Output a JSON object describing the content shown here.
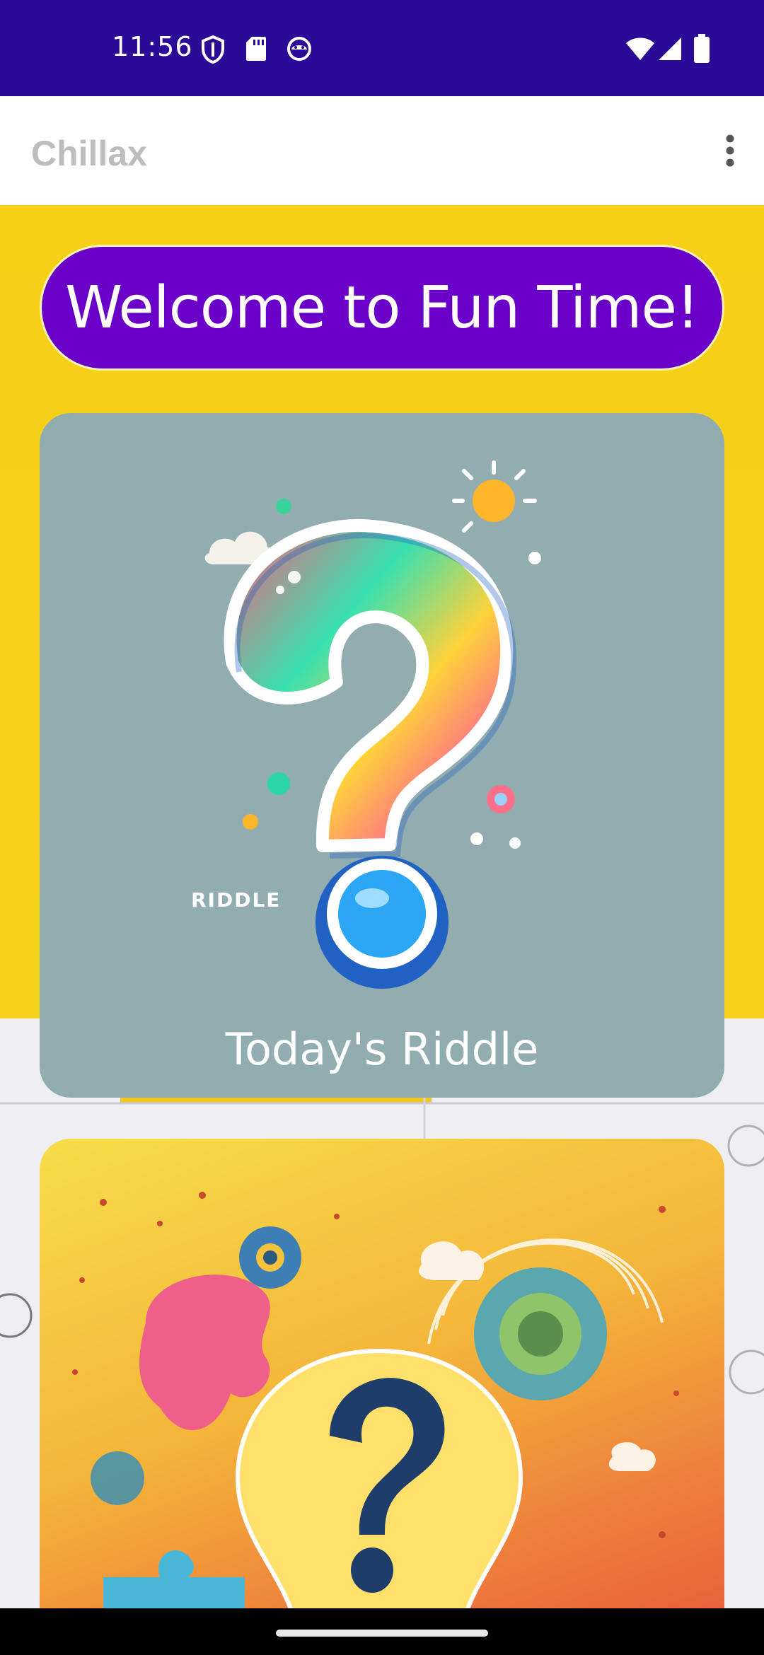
{
  "status_bar": {
    "time": "11:56",
    "left_icons": [
      "shield-icon",
      "sd-card-icon",
      "android-debug-icon"
    ],
    "right_icons": [
      "wifi-icon",
      "cell-signal-icon",
      "battery-icon"
    ],
    "background": "#2a0a96"
  },
  "app_bar": {
    "title": "Chillax",
    "menu_icon": "more-vert-icon"
  },
  "welcome": {
    "text": "Welcome to Fun Time!",
    "background": "#6a00c8"
  },
  "cards": [
    {
      "caption": "Today's Riddle",
      "image_label": "RIDDLE"
    }
  ],
  "colors": {
    "page_background": "#f6cf17",
    "card_background": "#92adb0"
  }
}
